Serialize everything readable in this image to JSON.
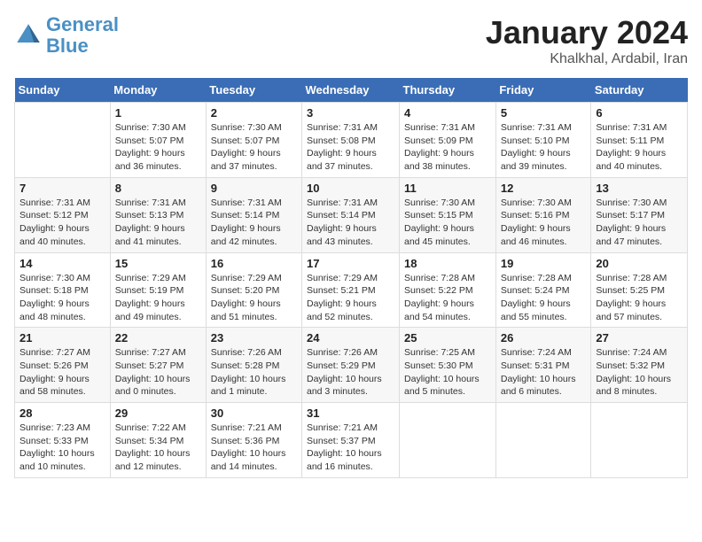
{
  "header": {
    "logo_line1": "General",
    "logo_line2": "Blue",
    "month_title": "January 2024",
    "subtitle": "Khalkhal, Ardabil, Iran"
  },
  "days_of_week": [
    "Sunday",
    "Monday",
    "Tuesday",
    "Wednesday",
    "Thursday",
    "Friday",
    "Saturday"
  ],
  "weeks": [
    [
      {
        "day": "",
        "info": ""
      },
      {
        "day": "1",
        "info": "Sunrise: 7:30 AM\nSunset: 5:07 PM\nDaylight: 9 hours\nand 36 minutes."
      },
      {
        "day": "2",
        "info": "Sunrise: 7:30 AM\nSunset: 5:07 PM\nDaylight: 9 hours\nand 37 minutes."
      },
      {
        "day": "3",
        "info": "Sunrise: 7:31 AM\nSunset: 5:08 PM\nDaylight: 9 hours\nand 37 minutes."
      },
      {
        "day": "4",
        "info": "Sunrise: 7:31 AM\nSunset: 5:09 PM\nDaylight: 9 hours\nand 38 minutes."
      },
      {
        "day": "5",
        "info": "Sunrise: 7:31 AM\nSunset: 5:10 PM\nDaylight: 9 hours\nand 39 minutes."
      },
      {
        "day": "6",
        "info": "Sunrise: 7:31 AM\nSunset: 5:11 PM\nDaylight: 9 hours\nand 40 minutes."
      }
    ],
    [
      {
        "day": "7",
        "info": "Sunrise: 7:31 AM\nSunset: 5:12 PM\nDaylight: 9 hours\nand 40 minutes."
      },
      {
        "day": "8",
        "info": "Sunrise: 7:31 AM\nSunset: 5:13 PM\nDaylight: 9 hours\nand 41 minutes."
      },
      {
        "day": "9",
        "info": "Sunrise: 7:31 AM\nSunset: 5:14 PM\nDaylight: 9 hours\nand 42 minutes."
      },
      {
        "day": "10",
        "info": "Sunrise: 7:31 AM\nSunset: 5:14 PM\nDaylight: 9 hours\nand 43 minutes."
      },
      {
        "day": "11",
        "info": "Sunrise: 7:30 AM\nSunset: 5:15 PM\nDaylight: 9 hours\nand 45 minutes."
      },
      {
        "day": "12",
        "info": "Sunrise: 7:30 AM\nSunset: 5:16 PM\nDaylight: 9 hours\nand 46 minutes."
      },
      {
        "day": "13",
        "info": "Sunrise: 7:30 AM\nSunset: 5:17 PM\nDaylight: 9 hours\nand 47 minutes."
      }
    ],
    [
      {
        "day": "14",
        "info": "Sunrise: 7:30 AM\nSunset: 5:18 PM\nDaylight: 9 hours\nand 48 minutes."
      },
      {
        "day": "15",
        "info": "Sunrise: 7:29 AM\nSunset: 5:19 PM\nDaylight: 9 hours\nand 49 minutes."
      },
      {
        "day": "16",
        "info": "Sunrise: 7:29 AM\nSunset: 5:20 PM\nDaylight: 9 hours\nand 51 minutes."
      },
      {
        "day": "17",
        "info": "Sunrise: 7:29 AM\nSunset: 5:21 PM\nDaylight: 9 hours\nand 52 minutes."
      },
      {
        "day": "18",
        "info": "Sunrise: 7:28 AM\nSunset: 5:22 PM\nDaylight: 9 hours\nand 54 minutes."
      },
      {
        "day": "19",
        "info": "Sunrise: 7:28 AM\nSunset: 5:24 PM\nDaylight: 9 hours\nand 55 minutes."
      },
      {
        "day": "20",
        "info": "Sunrise: 7:28 AM\nSunset: 5:25 PM\nDaylight: 9 hours\nand 57 minutes."
      }
    ],
    [
      {
        "day": "21",
        "info": "Sunrise: 7:27 AM\nSunset: 5:26 PM\nDaylight: 9 hours\nand 58 minutes."
      },
      {
        "day": "22",
        "info": "Sunrise: 7:27 AM\nSunset: 5:27 PM\nDaylight: 10 hours\nand 0 minutes."
      },
      {
        "day": "23",
        "info": "Sunrise: 7:26 AM\nSunset: 5:28 PM\nDaylight: 10 hours\nand 1 minute."
      },
      {
        "day": "24",
        "info": "Sunrise: 7:26 AM\nSunset: 5:29 PM\nDaylight: 10 hours\nand 3 minutes."
      },
      {
        "day": "25",
        "info": "Sunrise: 7:25 AM\nSunset: 5:30 PM\nDaylight: 10 hours\nand 5 minutes."
      },
      {
        "day": "26",
        "info": "Sunrise: 7:24 AM\nSunset: 5:31 PM\nDaylight: 10 hours\nand 6 minutes."
      },
      {
        "day": "27",
        "info": "Sunrise: 7:24 AM\nSunset: 5:32 PM\nDaylight: 10 hours\nand 8 minutes."
      }
    ],
    [
      {
        "day": "28",
        "info": "Sunrise: 7:23 AM\nSunset: 5:33 PM\nDaylight: 10 hours\nand 10 minutes."
      },
      {
        "day": "29",
        "info": "Sunrise: 7:22 AM\nSunset: 5:34 PM\nDaylight: 10 hours\nand 12 minutes."
      },
      {
        "day": "30",
        "info": "Sunrise: 7:21 AM\nSunset: 5:36 PM\nDaylight: 10 hours\nand 14 minutes."
      },
      {
        "day": "31",
        "info": "Sunrise: 7:21 AM\nSunset: 5:37 PM\nDaylight: 10 hours\nand 16 minutes."
      },
      {
        "day": "",
        "info": ""
      },
      {
        "day": "",
        "info": ""
      },
      {
        "day": "",
        "info": ""
      }
    ]
  ]
}
